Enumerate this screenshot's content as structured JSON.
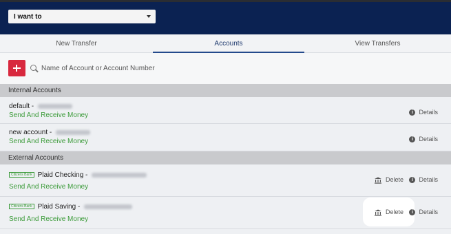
{
  "header": {
    "select_label": "I want to"
  },
  "tabs": [
    {
      "label": "New Transfer",
      "active": false
    },
    {
      "label": "Accounts",
      "active": true
    },
    {
      "label": "View Transfers",
      "active": false
    }
  ],
  "search": {
    "placeholder": "Name of Account or Account Number"
  },
  "internal_section": {
    "title": "Internal Accounts",
    "accounts": [
      {
        "name": "default - ",
        "action": "Send And Receive Money",
        "details_label": "Details"
      },
      {
        "name": "new account - ",
        "action": "Send And Receive Money",
        "details_label": "Details"
      }
    ]
  },
  "external_section": {
    "title": "External Accounts",
    "accounts": [
      {
        "bank_logo": "Citizens Bank",
        "name": "Plaid Checking - ",
        "action": "Send And Receive Money",
        "delete_label": "Delete",
        "details_label": "Details"
      },
      {
        "bank_logo": "Citizens Bank",
        "name": "Plaid Saving - ",
        "action": "Send And Receive Money",
        "delete_label": "Delete",
        "details_label": "Details"
      }
    ]
  },
  "colors": {
    "header_bg": "#0b2252",
    "add_button": "#d8283e",
    "action_green": "#3c9b3a",
    "active_tab": "#244a8c"
  },
  "icons": {
    "add": "plus-icon",
    "search": "search-icon",
    "details": "info-icon",
    "delete": "bank-delete-icon"
  }
}
